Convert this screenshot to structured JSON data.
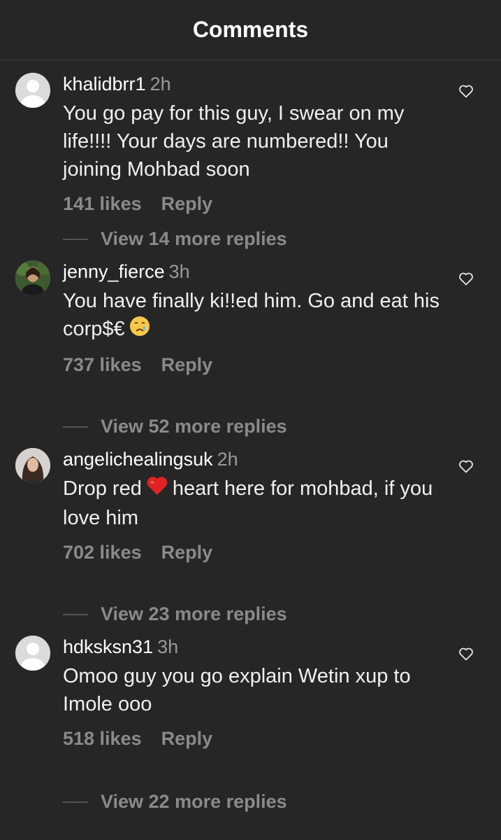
{
  "header": {
    "title": "Comments"
  },
  "comments": [
    {
      "username": "khalidbrr1",
      "time": "2h",
      "text": "You go pay for this guy, I swear on my life!!!! Your days are numbered!! You joining Mohbad soon",
      "likes": "141 likes",
      "reply": "Reply",
      "view_replies": "View 14 more replies",
      "avatar": "default-avatar-icon"
    },
    {
      "username": "jenny_fierce",
      "time": "3h",
      "text_before": "You have finally ki!!ed him. Go and eat his corp$€",
      "emoji": "crying-face-emoji",
      "likes": "737 likes",
      "reply": "Reply",
      "view_replies": "View 52 more replies",
      "avatar": "photo-avatar"
    },
    {
      "username": "angelichealingsuk",
      "time": "2h",
      "text_before": "Drop red",
      "emoji": "red-heart-emoji",
      "text_after": "heart here for mohbad, if you love him",
      "likes": "702 likes",
      "reply": "Reply",
      "view_replies": "View 23 more replies",
      "avatar": "photo-avatar"
    },
    {
      "username": "hdksksn31",
      "time": "3h",
      "text": "Omoo guy you go explain Wetin xup to Imole ooo",
      "likes": "518 likes",
      "reply": "Reply",
      "view_replies": "View 22 more replies",
      "avatar": "default-avatar-icon"
    }
  ],
  "colors": {
    "background": "#262626",
    "secondary_text": "#8a8a8a",
    "primary_text": "#f5f5f5"
  }
}
